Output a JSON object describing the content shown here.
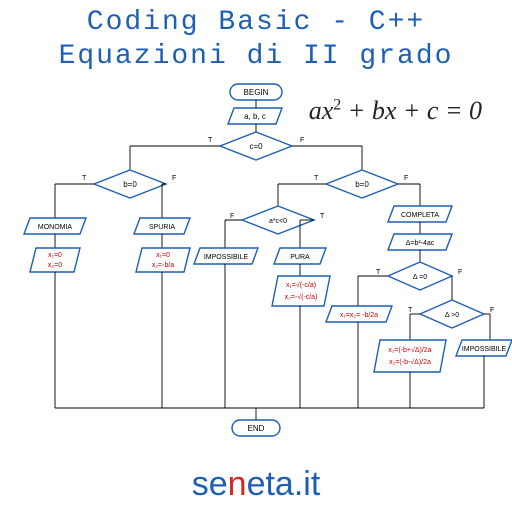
{
  "title": {
    "line1": "Coding Basic - C++",
    "line2": "Equazioni di II grado"
  },
  "equation": "ax² + bx + c = 0",
  "brand": {
    "pre": "se",
    "accent": "n",
    "suffix": "eta.it"
  },
  "flow": {
    "begin": "BEGIN",
    "end": "END",
    "input": "a, b, c",
    "dec_c0": "c=0",
    "dec_b0_left": "b=0",
    "dec_b0_right": "b=0",
    "dec_ac": "a*c<0",
    "dec_delta_eq": "Δ =0",
    "dec_delta_gt": "Δ >0",
    "monomia": "MONOMIA",
    "spuria": "SPURIA",
    "impossibile": "IMPOSSIBILE",
    "pura": "PURA",
    "completa": "COMPLETA",
    "delta_calc": "Δ=b²-4ac",
    "sol_monomia": "x₁=0  x₂=0",
    "sol_spuria": "x₁=0  x₂=-b/a",
    "sol_pura": "x₁=√(-c/a)  x₂=-√(-c/a)",
    "sol_delta0": "x₁=x₂= -b/2a",
    "sol_completa": "x₁=(-b+√Δ)/2a  x₂=(-b-√Δ)/2a",
    "T": "T",
    "F": "F"
  }
}
